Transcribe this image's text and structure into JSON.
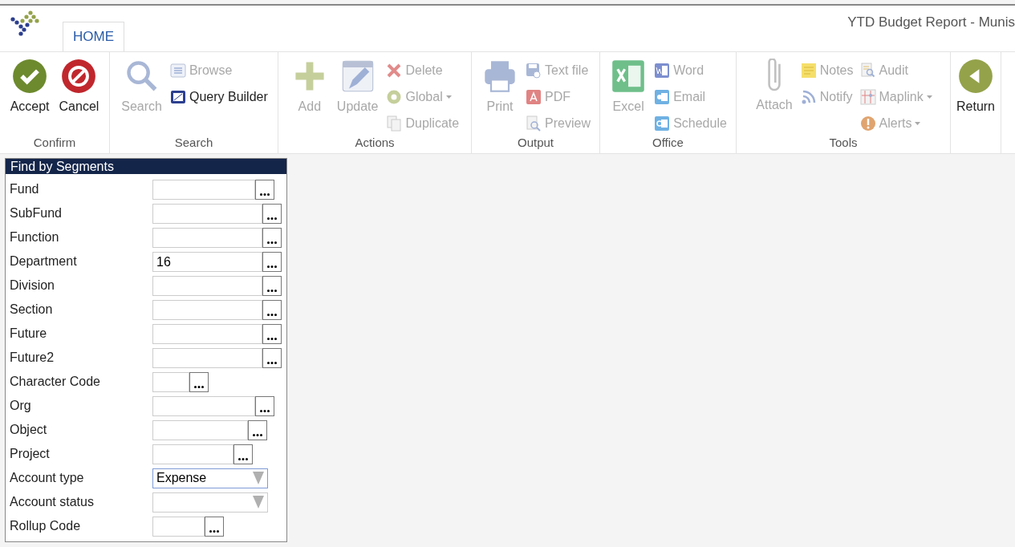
{
  "window": {
    "title": "YTD Budget Report - Munis"
  },
  "tabs": [
    {
      "label": "HOME",
      "selected": true
    }
  ],
  "ribbon": {
    "groups": [
      {
        "label": "Confirm",
        "large": [
          {
            "label": "Accept",
            "disabled": false
          },
          {
            "label": "Cancel",
            "disabled": false
          }
        ]
      },
      {
        "label": "Search",
        "large": [
          {
            "label": "Search",
            "disabled": true
          }
        ],
        "columns": [
          [
            {
              "label": "Browse",
              "disabled": true
            },
            {
              "label": "Query Builder",
              "disabled": false
            }
          ]
        ]
      },
      {
        "label": "Actions",
        "large": [
          {
            "label": "Add",
            "disabled": true
          },
          {
            "label": "Update",
            "disabled": true
          }
        ],
        "columns": [
          [
            {
              "label": "Delete",
              "disabled": true
            },
            {
              "label": "Global",
              "disabled": true,
              "dropdown": true
            },
            {
              "label": "Duplicate",
              "disabled": true
            }
          ]
        ]
      },
      {
        "label": "Output",
        "large": [
          {
            "label": "Print",
            "disabled": true
          }
        ],
        "columns": [
          [
            {
              "label": "Text file",
              "disabled": true
            },
            {
              "label": "PDF",
              "disabled": true
            },
            {
              "label": "Preview",
              "disabled": true
            }
          ]
        ]
      },
      {
        "label": "Office",
        "large": [
          {
            "label": "Excel",
            "disabled": true
          }
        ],
        "columns": [
          [
            {
              "label": "Word",
              "disabled": true
            },
            {
              "label": "Email",
              "disabled": true
            },
            {
              "label": "Schedule",
              "disabled": true
            }
          ]
        ]
      },
      {
        "label": "Tools",
        "large": [
          {
            "label": "Attach",
            "disabled": true
          }
        ],
        "columns": [
          [
            {
              "label": "Notes",
              "disabled": true
            },
            {
              "label": "Notify",
              "disabled": true
            }
          ],
          [
            {
              "label": "Audit",
              "disabled": true
            },
            {
              "label": "Maplink",
              "disabled": true,
              "dropdown": true
            },
            {
              "label": "Alerts",
              "disabled": true,
              "dropdown": true
            }
          ]
        ]
      },
      {
        "large": [
          {
            "label": "Return",
            "disabled": false
          }
        ]
      }
    ]
  },
  "panel": {
    "title": "Find by Segments",
    "fields": [
      {
        "kind": "lookup",
        "label": "Fund"
      },
      {
        "kind": "lookup",
        "label": "SubFund"
      },
      {
        "kind": "lookup",
        "label": "Function"
      },
      {
        "kind": "lookup",
        "label": "Department",
        "value": "16"
      },
      {
        "kind": "lookup",
        "label": "Division"
      },
      {
        "kind": "lookup",
        "label": "Section"
      },
      {
        "kind": "lookup",
        "label": "Future"
      },
      {
        "kind": "lookup",
        "label": "Future2"
      },
      {
        "kind": "lookup",
        "label": "Character Code"
      },
      {
        "kind": "lookup",
        "label": "Org"
      },
      {
        "kind": "lookup",
        "label": "Object"
      },
      {
        "kind": "lookup",
        "label": "Project"
      },
      {
        "kind": "dropdown",
        "label": "Account type",
        "value": "Expense",
        "focused": true
      },
      {
        "kind": "dropdown",
        "label": "Account status",
        "focused": false
      },
      {
        "kind": "lookup",
        "label": "Rollup Code"
      }
    ]
  }
}
